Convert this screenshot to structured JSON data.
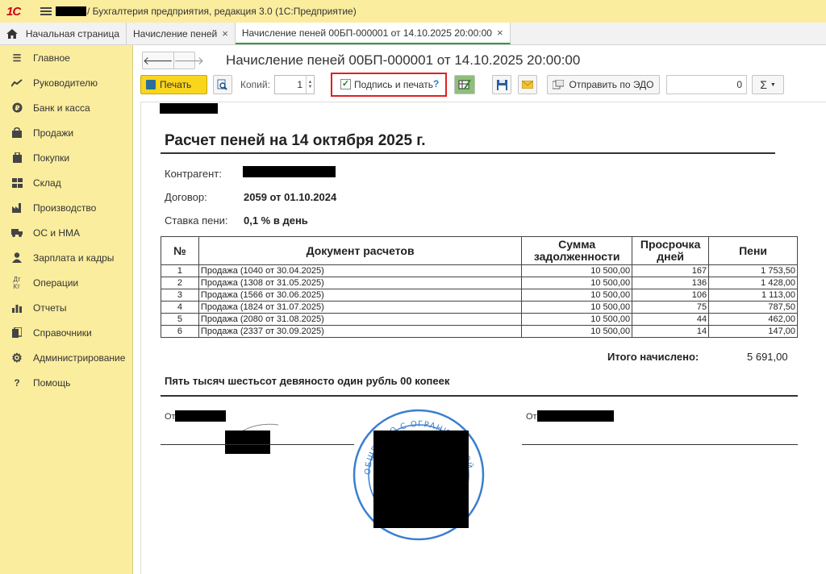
{
  "app": {
    "logo": "1С",
    "title": "/ Бухгалтерия предприятия, редакция 3.0  (1С:Предприятие)"
  },
  "tabs": [
    {
      "label": "Начальная страница"
    },
    {
      "label": "Начисление пеней"
    },
    {
      "label": "Начисление пеней 00БП-000001 от 14.10.2025 20:00:00"
    }
  ],
  "sidebar": {
    "items": [
      {
        "label": "Главное",
        "icon": "menu-icon"
      },
      {
        "label": "Руководителю",
        "icon": "trend-icon"
      },
      {
        "label": "Банк и касса",
        "icon": "coin-icon"
      },
      {
        "label": "Продажи",
        "icon": "bag-icon"
      },
      {
        "label": "Покупки",
        "icon": "cart-icon"
      },
      {
        "label": "Склад",
        "icon": "grid-icon"
      },
      {
        "label": "Производство",
        "icon": "factory-icon"
      },
      {
        "label": "ОС и НМА",
        "icon": "truck-icon"
      },
      {
        "label": "Зарплата и кадры",
        "icon": "person-icon"
      },
      {
        "label": "Операции",
        "icon": "dt-kt-icon"
      },
      {
        "label": "Отчеты",
        "icon": "bar-chart-icon"
      },
      {
        "label": "Справочники",
        "icon": "books-icon"
      },
      {
        "label": "Администрирование",
        "icon": "gear-icon"
      },
      {
        "label": "Помощь",
        "icon": "question-icon"
      }
    ]
  },
  "document": {
    "title": "Начисление пеней 00БП-000001 от 14.10.2025 20:00:00"
  },
  "toolbar": {
    "print_label": "Печать",
    "copies_label": "Копий:",
    "copies_value": "1",
    "sign_label": "Подпись и печать",
    "help": "?",
    "send_label": "Отправить по ЭДО",
    "sum_value": "0",
    "sigma": "Σ"
  },
  "report": {
    "title": "Расчет пеней на 14 октября 2025 г.",
    "counterparty_label": "Контрагент:",
    "contract_label": "Договор:",
    "contract_value": "2059 от 01.10.2024",
    "rate_label": "Ставка пени:",
    "rate_value": "0,1 % в день",
    "columns": [
      "№",
      "Документ расчетов",
      "Сумма задолженности",
      "Просрочка дней",
      "Пени"
    ],
    "rows": [
      {
        "n": "1",
        "doc": "Продажа (1040 от 30.04.2025)",
        "debt": "10 500,00",
        "days": "167",
        "penalty": "1 753,50"
      },
      {
        "n": "2",
        "doc": "Продажа (1308 от 31.05.2025)",
        "debt": "10 500,00",
        "days": "136",
        "penalty": "1 428,00"
      },
      {
        "n": "3",
        "doc": "Продажа (1566 от 30.06.2025)",
        "debt": "10 500,00",
        "days": "106",
        "penalty": "1 113,00"
      },
      {
        "n": "4",
        "doc": "Продажа (1824 от 31.07.2025)",
        "debt": "10 500,00",
        "days": "75",
        "penalty": "787,50"
      },
      {
        "n": "5",
        "doc": "Продажа (2080 от 31.08.2025)",
        "debt": "10 500,00",
        "days": "44",
        "penalty": "462,00"
      },
      {
        "n": "6",
        "doc": "Продажа (2337 от 30.09.2025)",
        "debt": "10 500,00",
        "days": "14",
        "penalty": "147,00"
      }
    ],
    "total_label": "Итого начислено:",
    "total_value": "5 691,00",
    "amount_words": "Пять тысяч шестьсот девяносто один рубль 00 копеек",
    "from_label": "От",
    "stamp_text": "ОБЩЕСТВО С ОГРАНИЧЕННОЙ ОТВЕТСТВЕННОСТЬЮ"
  },
  "colors": {
    "sidebar_bg": "#fbed9e",
    "print_button": "#f9d51c",
    "highlight": "#e02020",
    "active_tab": "#2f9c3c",
    "stamp": "#3a7fd0"
  }
}
